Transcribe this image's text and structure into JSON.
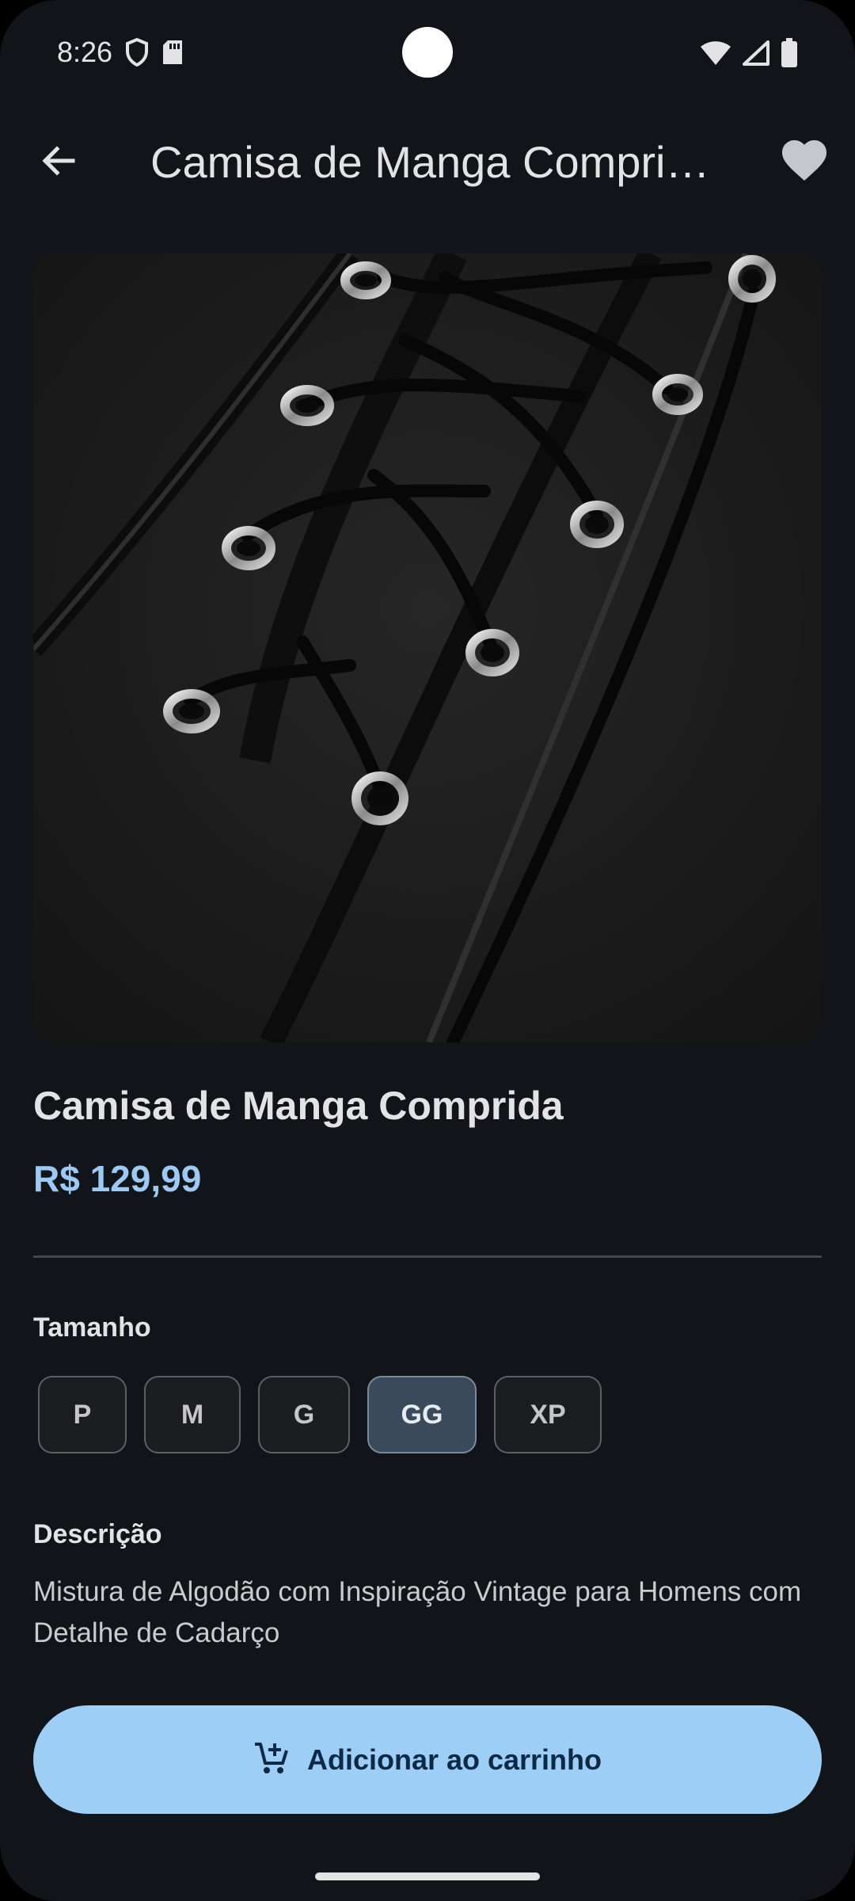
{
  "status_bar": {
    "time": "8:26",
    "icons": [
      "shield-icon",
      "sd-card-icon",
      "wifi-icon",
      "signal-icon",
      "battery-icon"
    ]
  },
  "app_bar": {
    "title": "Camisa de Manga Comprida",
    "back_icon": "arrow-back-icon",
    "favorite_icon": "heart-icon"
  },
  "product": {
    "image_alt": "",
    "name": "Camisa de Manga Comprida",
    "price": "R$ 129,99"
  },
  "size": {
    "label": "Tamanho",
    "options": [
      {
        "label": "P",
        "selected": false
      },
      {
        "label": "M",
        "selected": false
      },
      {
        "label": "G",
        "selected": false
      },
      {
        "label": "GG",
        "selected": true
      },
      {
        "label": "XP",
        "selected": false
      }
    ]
  },
  "description": {
    "label": "Descrição",
    "text": "Mistura de Algodão com Inspiração Vintage para Homens com Detalhe de Cadarço"
  },
  "cart_button": {
    "label": "Adicionar ao carrinho",
    "icon": "add-shopping-cart-icon"
  },
  "colors": {
    "background": "#111418",
    "accent": "#9ccaf4",
    "button": "#9ccef6",
    "chip_selected": "#3b4a5a"
  }
}
